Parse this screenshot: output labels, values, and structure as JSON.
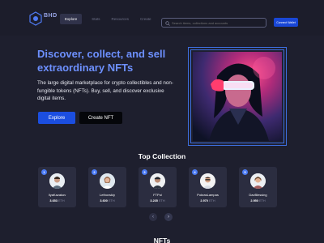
{
  "header": {
    "logo_text": "BHD",
    "nav": [
      "Explore",
      "Stats",
      "Resources",
      "Create"
    ],
    "search_placeholder": "Search items, collections and accounts",
    "connect_label": "Connect Wallet"
  },
  "hero": {
    "title_line1": "Discover, collect, and sell",
    "title_line2": "extraordinary NFTs",
    "description": "The large digital marketplace for crypto collectibles and non-fungible tokens (NFTs). Buy, sell, and discover exclusive digital items.",
    "explore_label": "Explore",
    "create_label": "Create NFT"
  },
  "top_collection": {
    "title": "Top Collection",
    "cards": [
      {
        "rank": "1",
        "name": "IlyaKazakov",
        "value": "3.653",
        "unit": "ETH"
      },
      {
        "rank": "2",
        "name": "Lethovskiy",
        "value": "3.600",
        "unit": "ETH"
      },
      {
        "rank": "3",
        "name": "FTPol",
        "value": "3.235",
        "unit": "ETH"
      },
      {
        "rank": "4",
        "name": "PokrasLampas",
        "value": "2.970",
        "unit": "ETH"
      },
      {
        "rank": "5",
        "name": "DavBlessing",
        "value": "2.950",
        "unit": "ETH"
      }
    ],
    "prev_icon": "‹",
    "next_icon": "›"
  },
  "nfts_title": "NFTs",
  "colors": {
    "background": "#1e1f2e",
    "accent": "#1b4ee0",
    "title": "#6d90ff"
  }
}
